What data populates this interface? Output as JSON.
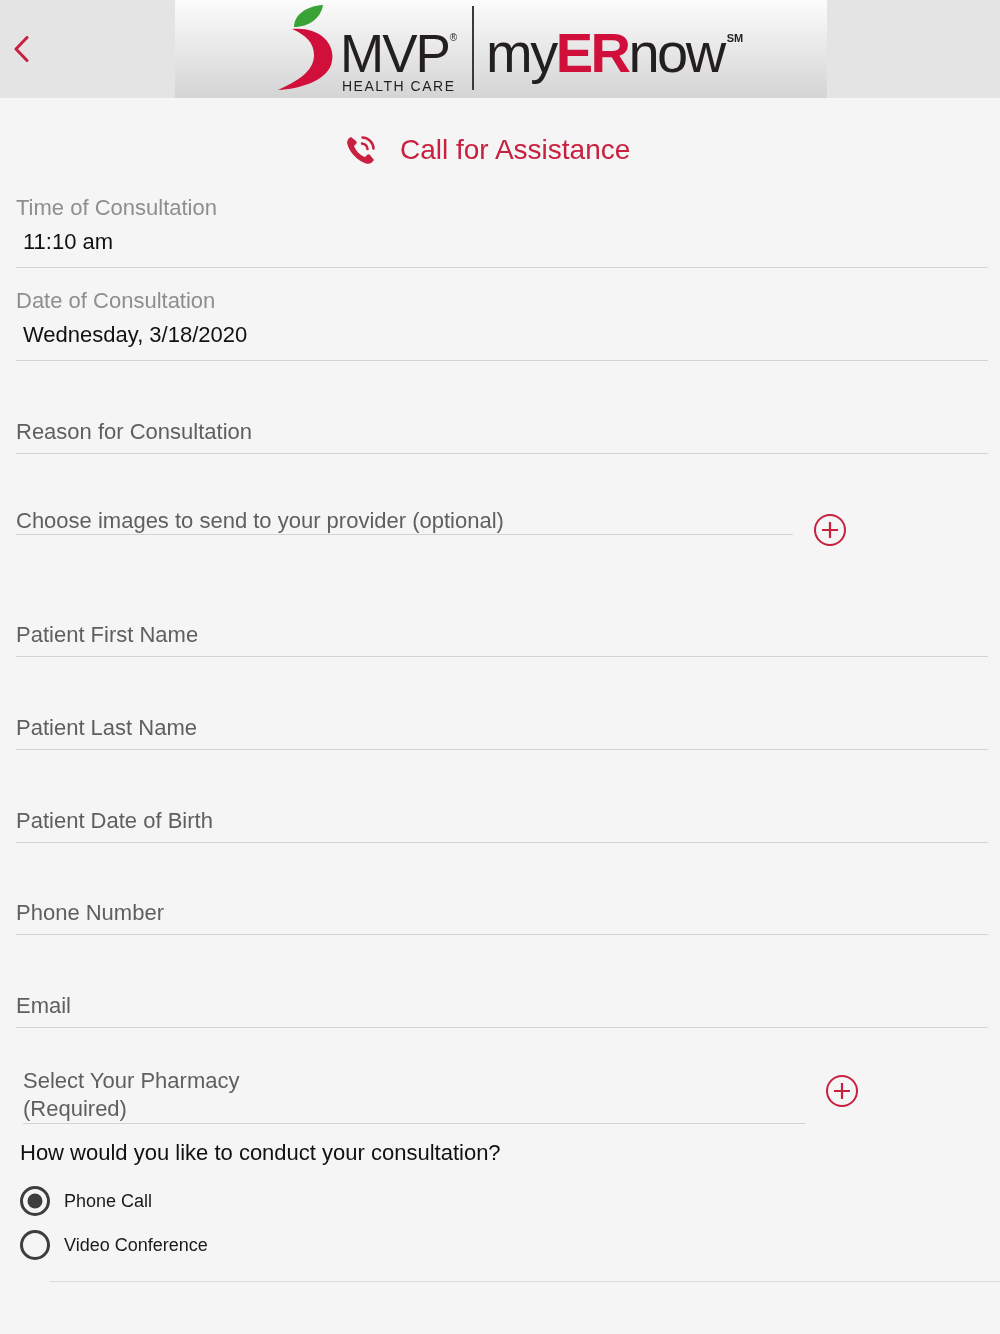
{
  "header": {
    "logo": {
      "brand": "MVP",
      "registered_mark": "®",
      "tagline": "HEALTH CARE",
      "product": "my**ER**now",
      "service_mark": "SM"
    }
  },
  "call_button": {
    "label": "Call for Assistance"
  },
  "fields": [
    {
      "kind": "value",
      "label": "Time of Consultation",
      "value": "11:10 am"
    },
    {
      "kind": "value",
      "label": "Date of Consultation",
      "value": "Wednesday, 3/18/2020"
    },
    {
      "kind": "text",
      "placeholder": "Reason for Consultation"
    },
    {
      "kind": "picker",
      "placeholder": "Choose images to send to your provider (optional)"
    },
    {
      "kind": "text",
      "placeholder": "Patient First Name"
    },
    {
      "kind": "text",
      "placeholder": "Patient Last Name"
    },
    {
      "kind": "text",
      "placeholder": "Patient Date of Birth"
    },
    {
      "kind": "text",
      "placeholder": "Phone Number"
    },
    {
      "kind": "text",
      "placeholder": "Email"
    },
    {
      "kind": "picker",
      "placeholder": "Select Your Pharmacy (Required)"
    }
  ],
  "consultation": {
    "question": "How would you like to conduct your consultation?",
    "options": [
      {
        "label": "Phone Call",
        "selected": true
      },
      {
        "label": "Video Conference",
        "selected": false
      }
    ]
  }
}
